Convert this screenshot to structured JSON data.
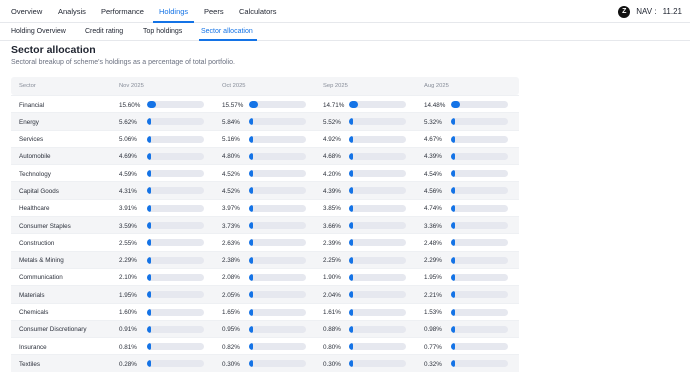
{
  "nav": {
    "tabs": [
      "Overview",
      "Analysis",
      "Performance",
      "Holdings",
      "Peers",
      "Calculators"
    ],
    "active": "Holdings",
    "logo_letter": "Z",
    "nav_label": "NAV :",
    "nav_value": "11.21"
  },
  "subnav": {
    "tabs": [
      "Holding Overview",
      "Credit rating",
      "Top holdings",
      "Sector allocation"
    ],
    "active": "Sector allocation"
  },
  "section": {
    "title": "Sector allocation",
    "subtitle": "Sectoral breakup of scheme's holdings as a percentage of total portfolio."
  },
  "table": {
    "headers": [
      "Sector",
      "Nov 2025",
      "Oct 2025",
      "Sep 2025",
      "Aug 2025"
    ],
    "max_percent": 16,
    "rows": [
      {
        "sector": "Financial",
        "values": [
          "15.60%",
          "15.57%",
          "14.71%",
          "14.48%"
        ]
      },
      {
        "sector": "Energy",
        "values": [
          "5.62%",
          "5.84%",
          "5.52%",
          "5.32%"
        ]
      },
      {
        "sector": "Services",
        "values": [
          "5.06%",
          "5.16%",
          "4.92%",
          "4.67%"
        ]
      },
      {
        "sector": "Automobile",
        "values": [
          "4.69%",
          "4.80%",
          "4.68%",
          "4.39%"
        ]
      },
      {
        "sector": "Technology",
        "values": [
          "4.59%",
          "4.52%",
          "4.20%",
          "4.54%"
        ]
      },
      {
        "sector": "Capital Goods",
        "values": [
          "4.31%",
          "4.52%",
          "4.39%",
          "4.56%"
        ]
      },
      {
        "sector": "Healthcare",
        "values": [
          "3.91%",
          "3.97%",
          "3.85%",
          "4.74%"
        ]
      },
      {
        "sector": "Consumer Staples",
        "values": [
          "3.59%",
          "3.73%",
          "3.66%",
          "3.36%"
        ]
      },
      {
        "sector": "Construction",
        "values": [
          "2.55%",
          "2.63%",
          "2.39%",
          "2.48%"
        ]
      },
      {
        "sector": "Metals & Mining",
        "values": [
          "2.29%",
          "2.38%",
          "2.25%",
          "2.29%"
        ]
      },
      {
        "sector": "Communication",
        "values": [
          "2.10%",
          "2.08%",
          "1.90%",
          "1.95%"
        ]
      },
      {
        "sector": "Materials",
        "values": [
          "1.95%",
          "2.05%",
          "2.04%",
          "2.21%"
        ]
      },
      {
        "sector": "Chemicals",
        "values": [
          "1.60%",
          "1.65%",
          "1.61%",
          "1.53%"
        ]
      },
      {
        "sector": "Consumer Discretionary",
        "values": [
          "0.91%",
          "0.95%",
          "0.88%",
          "0.98%"
        ]
      },
      {
        "sector": "Insurance",
        "values": [
          "0.81%",
          "0.82%",
          "0.80%",
          "0.77%"
        ]
      },
      {
        "sector": "Textiles",
        "values": [
          "0.28%",
          "0.30%",
          "0.30%",
          "0.32%"
        ]
      }
    ]
  },
  "colors": {
    "accent": "#1473e6",
    "bar_track": "#e6e8ef",
    "row_alt": "#f4f5f7"
  }
}
